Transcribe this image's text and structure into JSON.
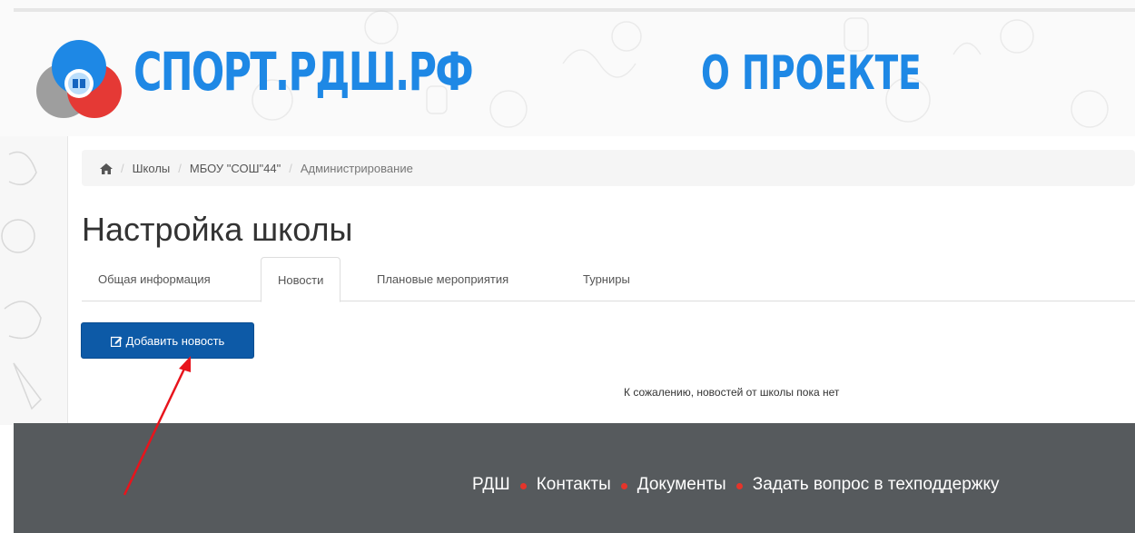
{
  "header": {
    "site_title": "СПОРТ.РДШ.РФ",
    "about_link": "О ПРОЕКТЕ"
  },
  "breadcrumb": {
    "items": [
      "Школы",
      "МБОУ \"СОШ\"44\"",
      "Администрирование"
    ]
  },
  "page": {
    "title": "Настройка школы"
  },
  "tabs": [
    {
      "label": "Общая информация"
    },
    {
      "label": "Новости",
      "active": true
    },
    {
      "label": "Плановые мероприятия"
    },
    {
      "label": "Турниры"
    }
  ],
  "actions": {
    "add_news_label": "Добавить новость"
  },
  "content": {
    "empty_message": "К сожалению, новостей от школы пока нет"
  },
  "footer": {
    "links": [
      "РДШ",
      "Контакты",
      "Документы",
      "Задать вопрос в техподдержку"
    ]
  },
  "colors": {
    "brand_blue": "#1e88e5",
    "button_blue": "#0d5aa7",
    "footer_bg": "#565a5d",
    "footer_dot": "#e5342a",
    "annotation_arrow": "#e8141c"
  }
}
